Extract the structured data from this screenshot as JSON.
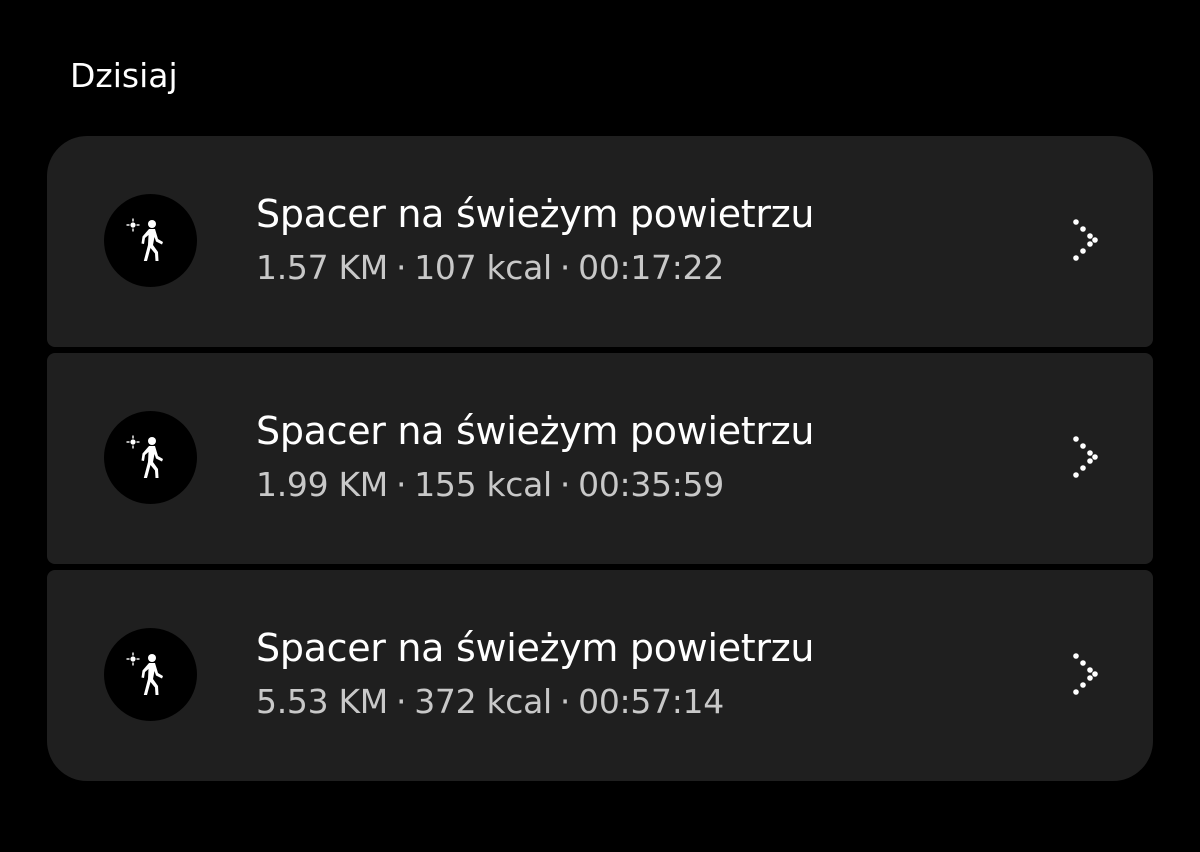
{
  "section": {
    "title": "Dzisiaj"
  },
  "activities": [
    {
      "title": "Spacer na świeżym powietrzu",
      "distance": "1.57 KM",
      "calories": "107 kcal",
      "duration": "00:17:22",
      "icon": "outdoor-walk-icon"
    },
    {
      "title": "Spacer na świeżym powietrzu",
      "distance": "1.99 KM",
      "calories": "155 kcal",
      "duration": "00:35:59",
      "icon": "outdoor-walk-icon"
    },
    {
      "title": "Spacer na świeżym powietrzu",
      "distance": "5.53 KM",
      "calories": "372 kcal",
      "duration": "00:57:14",
      "icon": "outdoor-walk-icon"
    }
  ],
  "separator": "·",
  "colors": {
    "background": "#000000",
    "card": "#1f1f1f",
    "title": "#ffffff",
    "meta": "#c8c8c8"
  }
}
